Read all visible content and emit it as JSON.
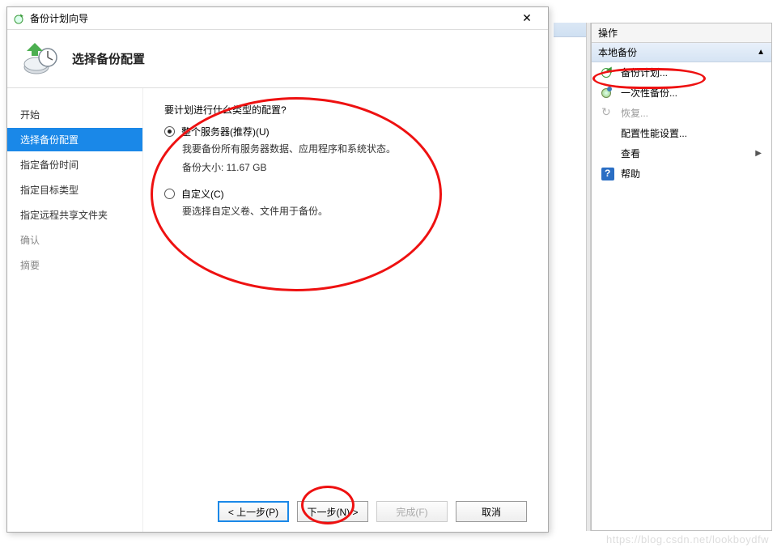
{
  "dialog": {
    "title": "备份计划向导",
    "heading": "选择备份配置"
  },
  "wizard_steps": [
    {
      "label": "开始",
      "state": "normal"
    },
    {
      "label": "选择备份配置",
      "state": "active"
    },
    {
      "label": "指定备份时间",
      "state": "normal"
    },
    {
      "label": "指定目标类型",
      "state": "normal"
    },
    {
      "label": "指定远程共享文件夹",
      "state": "normal"
    },
    {
      "label": "确认",
      "state": "disabled"
    },
    {
      "label": "摘要",
      "state": "disabled"
    }
  ],
  "question": "要计划进行什么类型的配置?",
  "options": [
    {
      "label": "整个服务器(推荐)(U)",
      "desc": "我要备份所有服务器数据、应用程序和系统状态。",
      "size_line": "备份大小: 11.67 GB",
      "checked": true
    },
    {
      "label": "自定义(C)",
      "desc": "要选择自定义卷、文件用于备份。",
      "size_line": "",
      "checked": false
    }
  ],
  "buttons": {
    "prev": "< 上一步(P)",
    "next": "下一步(N) >",
    "finish": "完成(F)",
    "cancel": "取消"
  },
  "actions_panel": {
    "header": "操作",
    "subheader": "本地备份",
    "items": [
      {
        "label": "备份计划...",
        "icon": "icon-schedule",
        "enabled": true
      },
      {
        "label": "一次性备份...",
        "icon": "icon-once",
        "enabled": true
      },
      {
        "label": "恢复...",
        "icon": "icon-recover",
        "enabled": false
      },
      {
        "label": "配置性能设置...",
        "icon": "",
        "enabled": true
      },
      {
        "label": "查看",
        "icon": "",
        "enabled": true,
        "submenu": true
      },
      {
        "label": "帮助",
        "icon": "icon-help",
        "enabled": true
      }
    ]
  },
  "watermark": "https://blog.csdn.net/lookboydfw"
}
